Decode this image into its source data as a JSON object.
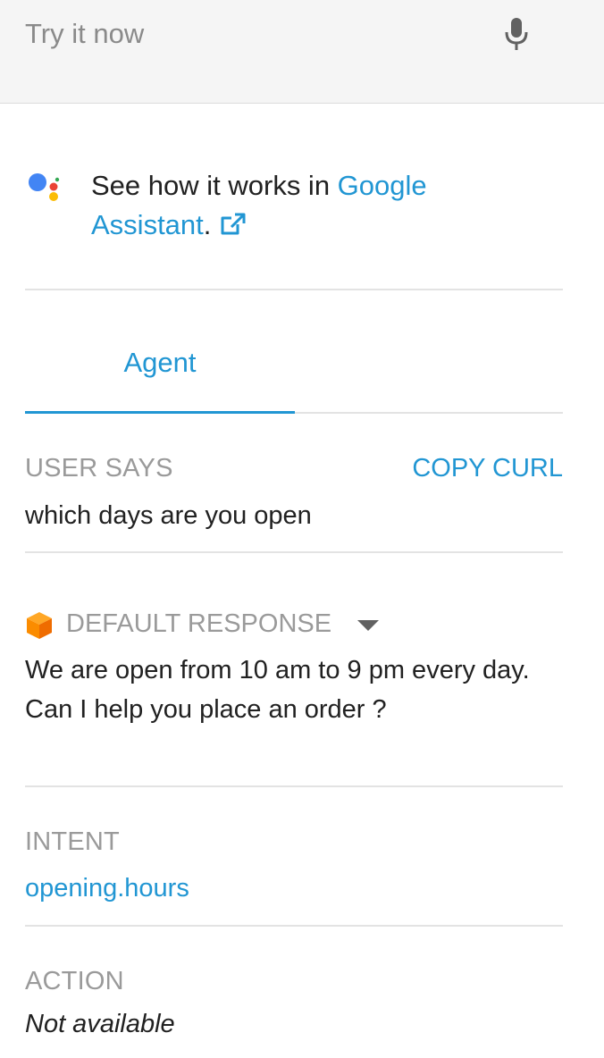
{
  "search": {
    "placeholder": "Try it now",
    "mic_icon": "microphone-icon"
  },
  "assistant": {
    "logo_icon": "google-assistant-logo",
    "prefix": "See how it works in ",
    "link_text_1": "Google",
    "link_text_2": "Assistant",
    "suffix": ".",
    "external_icon": "external-link-icon"
  },
  "tabs": [
    {
      "label": "Agent",
      "active": true
    }
  ],
  "user_says": {
    "label": "USER SAYS",
    "copy_label": "COPY CURL",
    "value": "which days are you open"
  },
  "response": {
    "icon": "cube-icon",
    "label": "DEFAULT RESPONSE",
    "text": "We are open from 10 am to 9 pm every day. Can I help you place an order ?"
  },
  "intent": {
    "label": "INTENT",
    "value": "opening.hours"
  },
  "action": {
    "label": "ACTION",
    "value": "Not available"
  },
  "colors": {
    "accent": "#2196d3",
    "label_gray": "#9a9a9a",
    "cube_orange": "#f57c00"
  }
}
